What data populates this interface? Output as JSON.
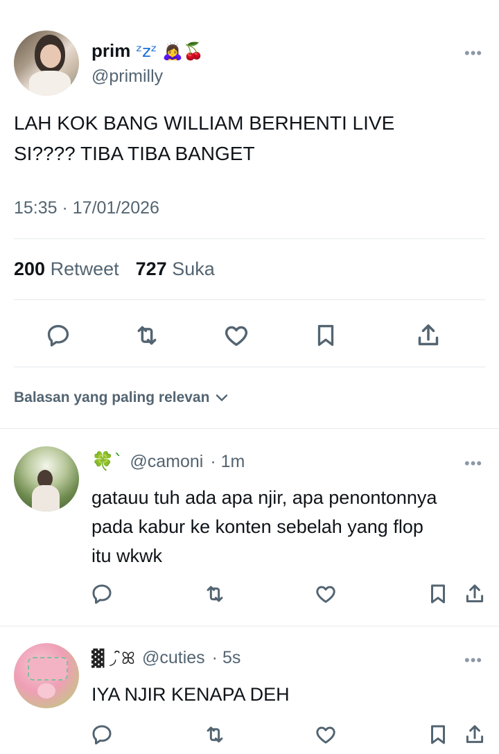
{
  "tweet": {
    "display_name": "prim",
    "name_emoji": "ᶻzᶻ 🙇‍♀️🍒",
    "handle": "@primilly",
    "text_line1": "LAH KOK BANG WILLIAM BERHENTI LIVE",
    "text_line2": "SI???? TIBA TIBA BANGET",
    "timestamp": "15:35 · 17/01/2026",
    "retweets": "200",
    "retweets_label": "Retweet",
    "likes": "727",
    "likes_label": "Suka",
    "more": "•••"
  },
  "sort_label": "Balasan yang paling relevan",
  "replies": [
    {
      "name_emoji": "🍀`",
      "handle": "@camoni",
      "time": "· 1m",
      "lines": [
        "gatauu tuh ada apa njir, apa penontonnya",
        "pada kabur ke konten sebelah yang flop",
        "itu wkwk"
      ],
      "more": "•••"
    },
    {
      "name_emoji": "▓ ◞ ̑̑ꕤ",
      "handle": "@cuties",
      "time": "· 5s",
      "lines": [
        "IYA NJIR KENAPA DEH"
      ],
      "more": "•••"
    }
  ],
  "icons": [
    "reply-icon",
    "retweet-icon",
    "like-icon",
    "bookmark-icon",
    "share-icon",
    "chevron-down-icon"
  ],
  "colors": {
    "text": "#0f1419",
    "secondary": "#536471",
    "divider": "#e6e9eb"
  }
}
